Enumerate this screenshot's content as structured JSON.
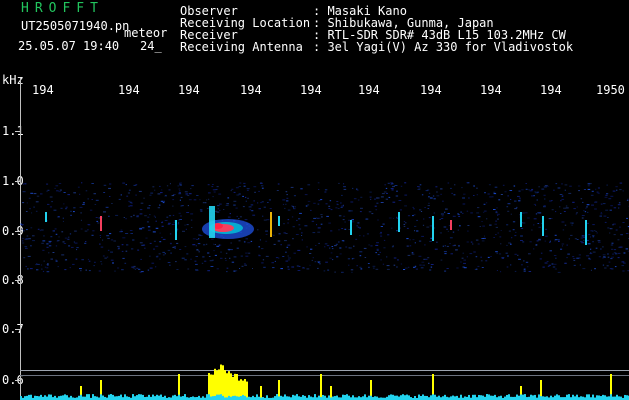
{
  "header": {
    "app_title": "HROFFT",
    "file_name": "UT2505071940.pn",
    "timestamp": "25.05.07 19:40",
    "extra": "24_",
    "tag": "meteor"
  },
  "info": [
    {
      "label": "Observer",
      "value": ": Masaki Kano"
    },
    {
      "label": "Receiving Location",
      "value": ": Shibukawa, Gunma, Japan"
    },
    {
      "label": "Receiver",
      "value": ": RTL-SDR SDR# 43dB L15 103.2MHz CW"
    },
    {
      "label": "Receiving Antenna",
      "value": ": 3el Yagi(V) Az 330 for Vladivostok"
    }
  ],
  "y_axis": {
    "unit": "kHz",
    "ticks": [
      "1.1",
      "1.0",
      "0.9",
      "0.8",
      "0.7",
      "0.6"
    ]
  },
  "x_axis": {
    "ticks": [
      "194",
      "194",
      "194",
      "194",
      "194",
      "194",
      "194",
      "194",
      "194",
      "1950"
    ]
  },
  "colors": {
    "background": "#000000",
    "title_green": "#22c55e",
    "text_white": "#ffffff",
    "baseline_cyan": "#22d3ee",
    "spike_yellow": "#ffff00"
  }
}
